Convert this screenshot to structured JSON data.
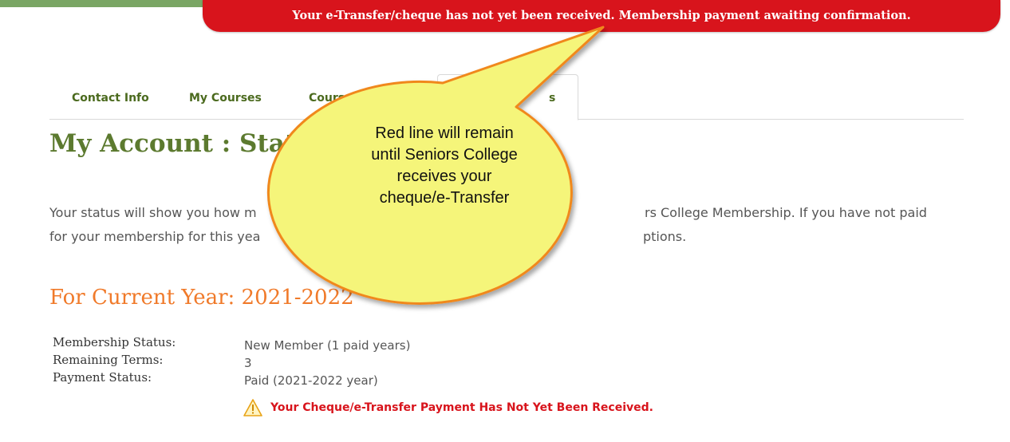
{
  "banner": {
    "text": "Your e-Transfer/cheque has not yet been received. Membership payment awaiting confirmation."
  },
  "tabs": [
    {
      "label": "Contact Info"
    },
    {
      "label": "My Courses"
    },
    {
      "label": "Course L"
    },
    {
      "label": "s"
    }
  ],
  "page": {
    "title": "My Account : Statu",
    "intro_line1_start": "Your status will show you how m",
    "intro_line1_end": "rs College Membership. If you have not paid",
    "intro_line2_start": "for your membership for this yea",
    "intro_line2_end": "ptions.",
    "section_heading": "For Current Year: 2021-2022"
  },
  "details": [
    {
      "label": "Membership Status:",
      "value": "New Member (1 paid years)"
    },
    {
      "label": "Remaining Terms:",
      "value": "3"
    },
    {
      "label": "Payment Status:",
      "value": "Paid (2021-2022 year)"
    }
  ],
  "warning": {
    "icon": "warning-triangle-icon",
    "text": "Your Cheque/e-Transfer Payment Has Not Yet Been Received."
  },
  "callout": {
    "lines": [
      "Red line will remain",
      "until Seniors College",
      "receives your",
      "cheque/e-Transfer"
    ]
  },
  "colors": {
    "banner_red": "#d8141c",
    "tab_green": "#4b6a1e",
    "title_green": "#5c7a2f",
    "heading_orange": "#f07a2a",
    "callout_fill": "#f5f57a",
    "callout_stroke": "#f0881e"
  }
}
